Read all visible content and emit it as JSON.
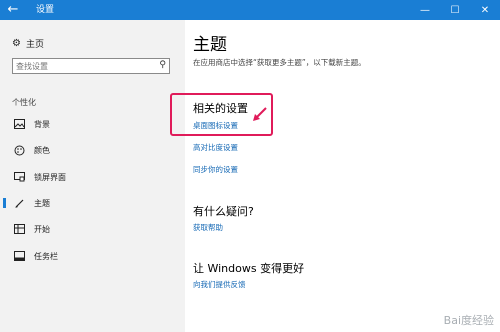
{
  "window": {
    "title": "设置",
    "back_glyph": "←",
    "minimize_glyph": "—",
    "maximize_glyph": "☐",
    "close_glyph": "✕"
  },
  "sidebar": {
    "home_label": "主页",
    "search_placeholder": "查找设置",
    "section_label": "个性化",
    "items": [
      {
        "label": "背景",
        "icon": "background-icon"
      },
      {
        "label": "颜色",
        "icon": "color-palette-icon"
      },
      {
        "label": "锁屏界面",
        "icon": "lock-screen-icon"
      },
      {
        "label": "主题",
        "icon": "theme-brush-icon",
        "active": true
      },
      {
        "label": "开始",
        "icon": "start-icon"
      },
      {
        "label": "任务栏",
        "icon": "taskbar-icon"
      }
    ]
  },
  "main": {
    "title": "主题",
    "description": "在应用商店中选择“获取更多主题”，以下载新主题。",
    "related": {
      "heading": "相关的设置",
      "links": [
        "桌面图标设置",
        "高对比度设置",
        "同步你的设置"
      ]
    },
    "question": {
      "heading": "有什么疑问?",
      "link": "获取帮助"
    },
    "better": {
      "heading": "让 Windows 变得更好",
      "link": "向我们提供反馈"
    }
  },
  "watermark": "Bai度经验",
  "colors": {
    "titlebar": "#1a7ed4",
    "sidebar_bg": "#f2f2f2",
    "link": "#1669b5",
    "highlight": "#e01b5a"
  }
}
